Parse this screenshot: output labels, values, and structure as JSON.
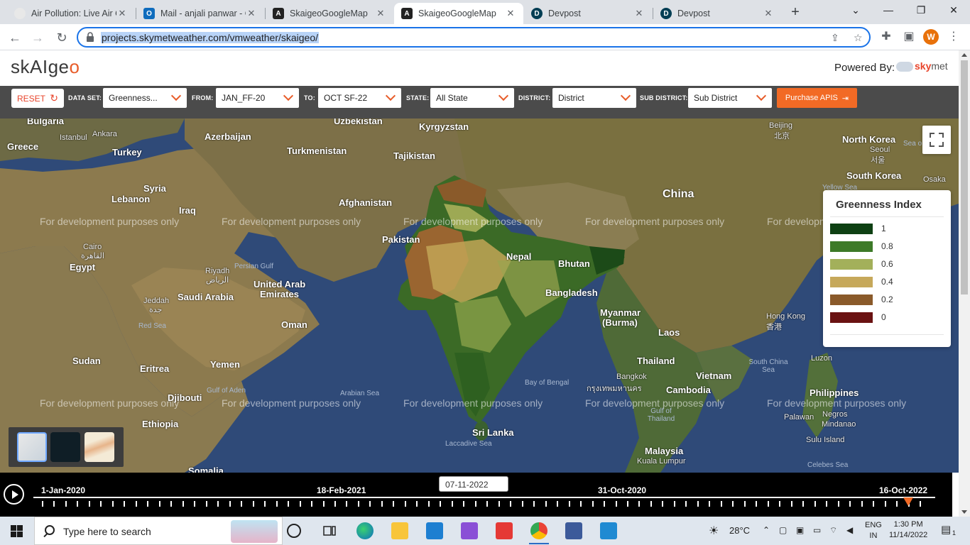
{
  "browser": {
    "tabs": [
      {
        "title": "Air Pollution: Live Air Q",
        "favicon_color": "#e8e8e8",
        "favicon_glyph": ""
      },
      {
        "title": "Mail - anjali panwar - O",
        "favicon_color": "#0f6cbd",
        "favicon_glyph": "O"
      },
      {
        "title": "SkaigeoGoogleMap",
        "favicon_color": "#222222",
        "favicon_glyph": "A"
      },
      {
        "title": "SkaigeoGoogleMap",
        "favicon_color": "#222222",
        "favicon_glyph": "A"
      },
      {
        "title": "Devpost",
        "favicon_color": "#003e54",
        "favicon_glyph": "D"
      },
      {
        "title": "Devpost",
        "favicon_color": "#003e54",
        "favicon_glyph": "D"
      }
    ],
    "active_tab": 3,
    "url": "projects.skymetweather.com/vmweather/skaigeo/",
    "profile_initial": "W"
  },
  "site": {
    "logo": "skAIge",
    "logo_tail": "o",
    "powered_by": "Powered By:",
    "brand_sky": "sky",
    "brand_met": "met"
  },
  "filters": {
    "reset_label": "RESET",
    "dataset_label": "DATA SET:",
    "dataset_value": "Greenness...",
    "from_label": "FROM:",
    "from_value": "JAN_FF-20",
    "to_label": "TO:",
    "to_value": "OCT SF-22",
    "state_label": "STATE:",
    "state_value": "All State",
    "district_label": "DISTRICT:",
    "district_value": "District",
    "subdistrict_label": "SUB DISTRICT:",
    "subdistrict_value": "Sub District",
    "purchase_label": "Purchase APIS"
  },
  "map": {
    "watermark": "For development purposes only",
    "labels": {
      "bulgaria": "Bulgaria",
      "uzbekistan": "Uzbekistan",
      "kyrgyzstan": "Kyrgyzstan",
      "beijing": "Beijing",
      "beijing_cn": "北京",
      "greece": "Greece",
      "istanbul": "Istanbul",
      "ankara": "Ankara",
      "turkey": "Turkey",
      "azerbaijan": "Azerbaijan",
      "turkmenistan": "Turkmenistan",
      "tajikistan": "Tajikistan",
      "north_korea": "North Korea",
      "seoul": "Seoul",
      "seoul_kr": "서울",
      "south_korea": "South Korea",
      "osaka": "Osaka",
      "syria": "Syria",
      "lebanon": "Lebanon",
      "iraq": "Iraq",
      "afghanistan": "Afghanistan",
      "china": "China",
      "pakistan": "Pakistan",
      "cairo": "Cairo",
      "cairo_ar": "القاهرة",
      "egypt": "Egypt",
      "nepal": "Nepal",
      "bhutan": "Bhutan",
      "riyadh": "Riyadh",
      "riyadh_ar": "الرياض",
      "persian_gulf": "Persian Gulf",
      "uae1": "United Arab",
      "uae2": "Emirates",
      "saudi": "Saudi Arabia",
      "jeddah": "Jeddah",
      "jeddah_ar": "جدة",
      "red_sea": "Red Sea",
      "bangladesh": "Bangladesh",
      "myanmar": "Myanmar",
      "burma": "(Burma)",
      "hongkong": "Hong Kong",
      "hongkong_cn": "香港",
      "laos": "Laos",
      "oman": "Oman",
      "sudan": "Sudan",
      "eritrea": "Eritrea",
      "yemen": "Yemen",
      "thailand": "Thailand",
      "vietnam": "Vietnam",
      "south_china_sea": "South China Sea",
      "luzon": "Luzon",
      "gulf_aden": "Gulf of Aden",
      "arabian_sea": "Arabian Sea",
      "bay_bengal": "Bay of Bengal",
      "bangkok": "Bangkok",
      "bangkok_th": "กรุงเทพมหานคร",
      "cambodia": "Cambodia",
      "philippines": "Philippines",
      "djibouti": "Djibouti",
      "ethiopia": "Ethiopia",
      "gulf_thailand": "Gulf of Thailand",
      "palawan": "Palawan",
      "negros": "Negros",
      "mindanao": "Mindanao",
      "sri_lanka": "Sri Lanka",
      "laccadive": "Laccadive Sea",
      "malaysia": "Malaysia",
      "kuala_lumpur": "Kuala Lumpur",
      "sulu": "Sulu Island",
      "celebes": "Celebes Sea",
      "somalia": "Somalia",
      "yellow_sea": "Yellow Sea",
      "sea_japan": "Sea o"
    }
  },
  "legend": {
    "title": "Greenness Index",
    "items": [
      {
        "value": "1",
        "color": "#0e4013"
      },
      {
        "value": "0.8",
        "color": "#3d7a28"
      },
      {
        "value": "0.6",
        "color": "#a3b05a"
      },
      {
        "value": "0.4",
        "color": "#c6a85a"
      },
      {
        "value": "0.2",
        "color": "#8a5a2a"
      },
      {
        "value": "0",
        "color": "#6a1212"
      }
    ]
  },
  "timeline": {
    "dates": [
      "1-Jan-2020",
      "18-Feb-2021",
      "31-Oct-2020",
      "16-Oct-2022"
    ],
    "current": "07-11-2022",
    "position": 0.97
  },
  "taskbar": {
    "search_placeholder": "Type here to search",
    "temperature": "28°C",
    "lang1": "ENG",
    "lang2": "IN",
    "time": "1:30 PM",
    "date": "11/14/2022",
    "notification_count": "1"
  }
}
